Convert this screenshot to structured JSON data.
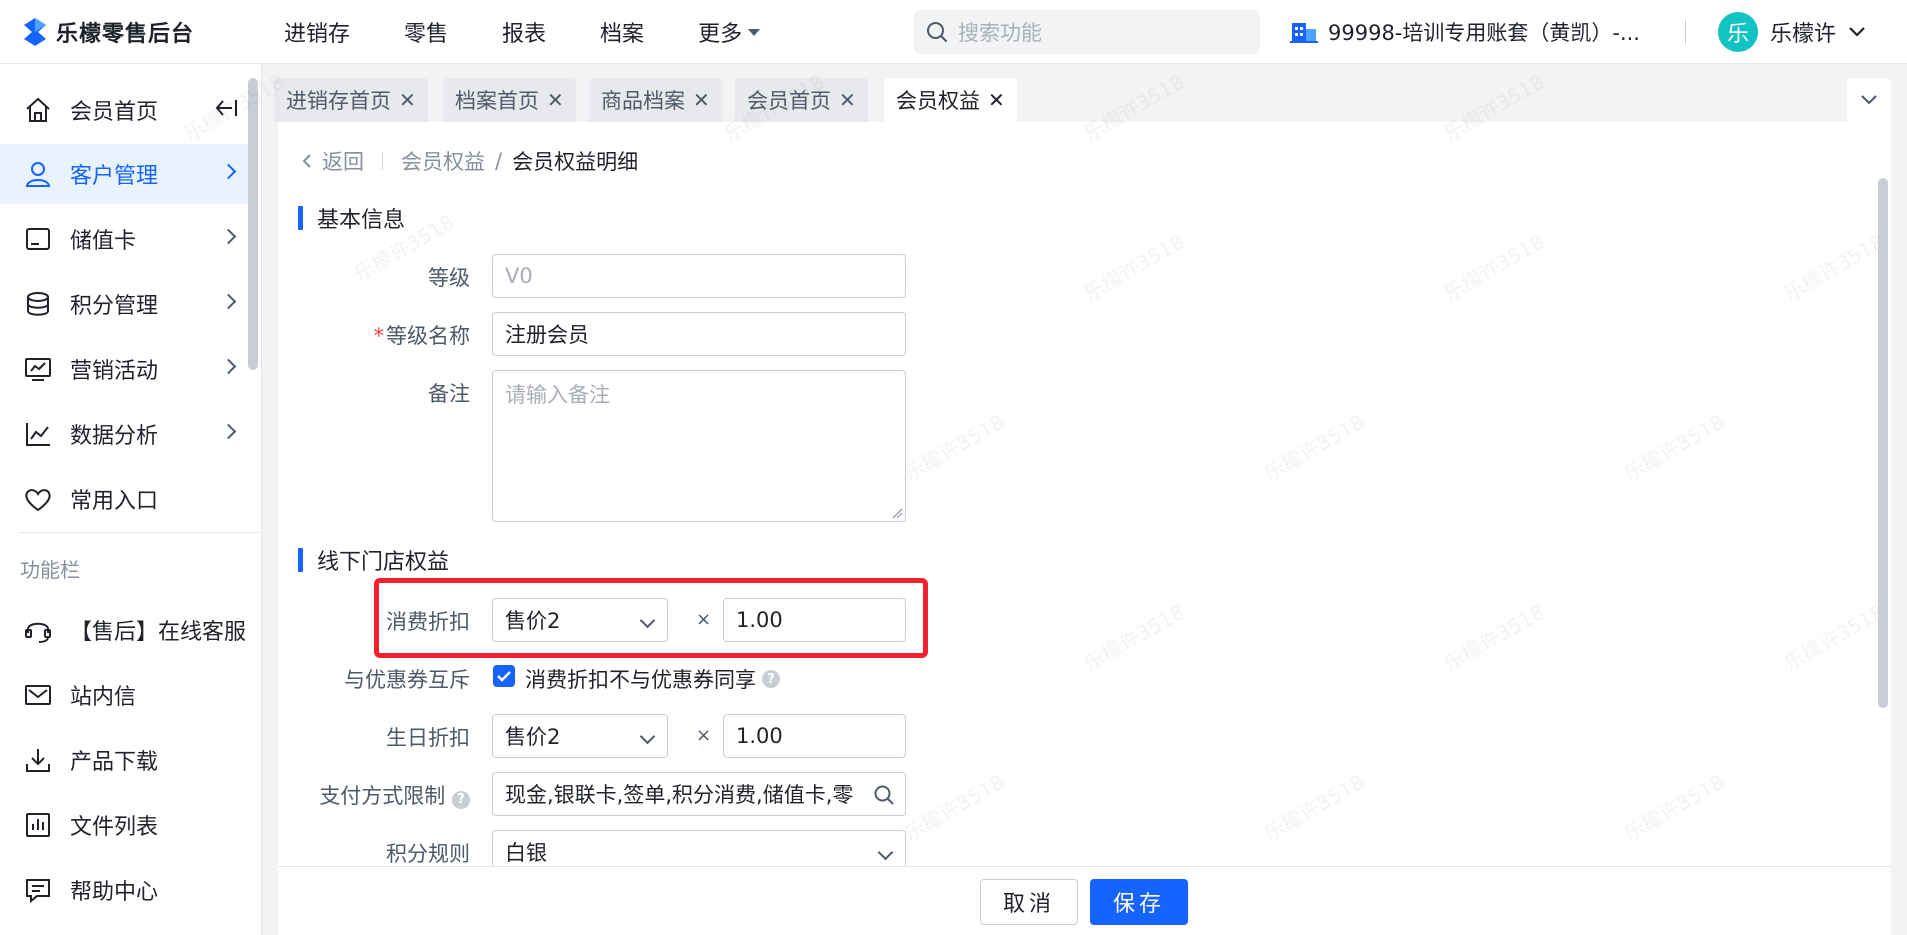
{
  "app": {
    "title": "乐檬零售后台",
    "brand_color": "#1664ff"
  },
  "topnav": [
    "进销存",
    "零售",
    "报表",
    "档案",
    "更多"
  ],
  "search": {
    "placeholder": "搜索功能"
  },
  "account": {
    "label": "99998-培训专用账套（黄凯）-..."
  },
  "user": {
    "avatar": "乐",
    "name": "乐檬许"
  },
  "sidebar": {
    "items": [
      {
        "label": "会员首页"
      },
      {
        "label": "客户管理"
      },
      {
        "label": "储值卡"
      },
      {
        "label": "积分管理"
      },
      {
        "label": "营销活动"
      },
      {
        "label": "数据分析"
      },
      {
        "label": "常用入口"
      }
    ],
    "section": "功能栏",
    "tools": [
      {
        "label": "【售后】在线客服"
      },
      {
        "label": "站内信"
      },
      {
        "label": "产品下载"
      },
      {
        "label": "文件列表"
      },
      {
        "label": "帮助中心"
      }
    ]
  },
  "tabs": [
    {
      "label": "进销存首页"
    },
    {
      "label": "档案首页"
    },
    {
      "label": "商品档案"
    },
    {
      "label": "会员首页"
    },
    {
      "label": "会员权益"
    }
  ],
  "breadcrumb": {
    "back": "返回",
    "parent": "会员权益",
    "sep": "/",
    "current": "会员权益明细"
  },
  "basic": {
    "title": "基本信息",
    "level_label": "等级",
    "level_value": "V0",
    "name_label": "等级名称",
    "name_required": "*",
    "name_value": "注册会员",
    "remark_label": "备注",
    "remark_placeholder": "请输入备注"
  },
  "offline": {
    "title": "线下门店权益",
    "discount_label": "消费折扣",
    "discount_price": "售价2",
    "times": "×",
    "discount_rate": "1.00",
    "coupon_label": "与优惠券互斥",
    "coupon_check_label": "消费折扣不与优惠券同享",
    "help": "?",
    "birthday_label": "生日折扣",
    "birthday_price": "售价2",
    "birthday_rate": "1.00",
    "payment_label": "支付方式限制",
    "payment_value": "现金,银联卡,签单,积分消费,储值卡,零",
    "points_label": "积分规则",
    "points_value": "白银"
  },
  "footer": {
    "cancel": "取消",
    "save": "保存"
  },
  "watermark": "乐檬许3518"
}
